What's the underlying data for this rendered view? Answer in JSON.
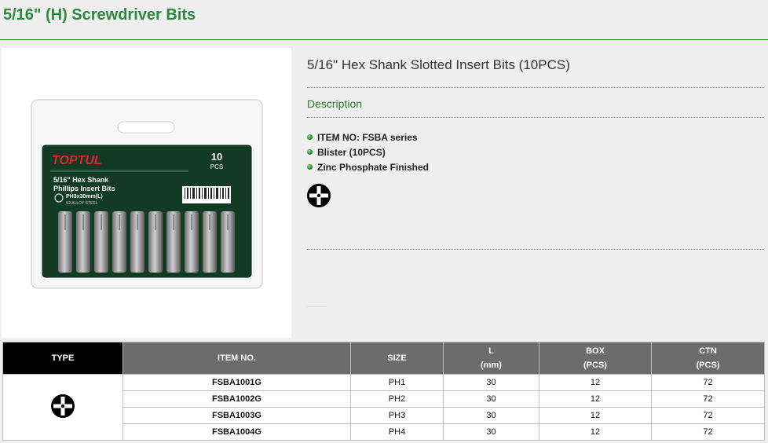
{
  "header": {
    "title": "5/16\" (H) Screwdriver Bits"
  },
  "product": {
    "name": "5/16\" Hex Shank Slotted Insert Bits (10PCS)",
    "description_heading": "Description",
    "features": [
      "ITEM NO: FSBA series",
      "Blister (10PCS)",
      "Zinc Phosphate Finished"
    ],
    "type_icon": "phillips-cross-icon",
    "image": {
      "brand": "TOPTUL",
      "count": "10",
      "count_unit": "PCS",
      "line1": "5/16\" Hex Shank",
      "line2": "Phillips Insert Bits",
      "spec": "PH3x30mm(L)",
      "material": "S2 ALLOY STEEL"
    }
  },
  "table": {
    "headers": {
      "type": "TYPE",
      "item_no": "ITEM NO.",
      "size": "SIZE",
      "l": "L",
      "l_unit": "(mm)",
      "box": "BOX",
      "box_unit": "(PCS)",
      "ctn": "CTN",
      "ctn_unit": "(PCS)"
    },
    "rows": [
      {
        "item": "FSBA1001G",
        "size": "PH1",
        "l": "30",
        "box": "12",
        "ctn": "72"
      },
      {
        "item": "FSBA1002G",
        "size": "PH2",
        "l": "30",
        "box": "12",
        "ctn": "72"
      },
      {
        "item": "FSBA1003G",
        "size": "PH3",
        "l": "30",
        "box": "12",
        "ctn": "72"
      },
      {
        "item": "FSBA1004G",
        "size": "PH4",
        "l": "30",
        "box": "12",
        "ctn": "72"
      }
    ]
  },
  "colors": {
    "accent": "#2b8a3e",
    "header_bg": "#6c6c6c",
    "type_header_bg": "#000000",
    "page_bg": "#efefef"
  }
}
